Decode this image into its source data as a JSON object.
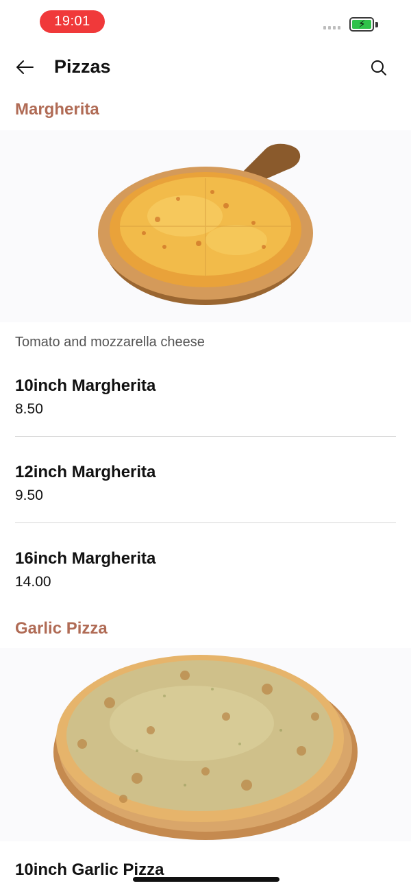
{
  "status_bar": {
    "time": "19:01",
    "battery_color": "#2fc24a"
  },
  "header": {
    "title": "Pizzas",
    "back_icon": "arrow-left-icon",
    "search_icon": "search-icon"
  },
  "colors": {
    "section_title": "#b06b55",
    "time_pill": "#f0393a",
    "divider": "#d8d8d8"
  },
  "sections": [
    {
      "title": "Margherita",
      "image": "margherita-pizza-image",
      "description": "Tomato and mozzarella cheese",
      "items": [
        {
          "name": "10inch Margherita",
          "price": "8.50"
        },
        {
          "name": "12inch Margherita",
          "price": "9.50"
        },
        {
          "name": "16inch Margherita",
          "price": "14.00"
        }
      ]
    },
    {
      "title": "Garlic Pizza",
      "image": "garlic-pizza-image",
      "items": [
        {
          "name": "10inch Garlic Pizza"
        }
      ]
    }
  ]
}
